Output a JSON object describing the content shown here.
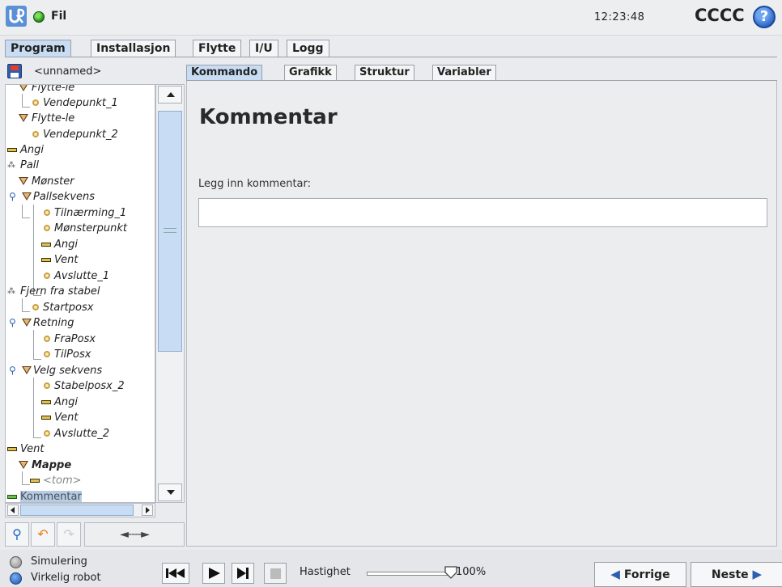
{
  "header": {
    "file_menu": "Fil",
    "clock": "12:23:48",
    "robot_name": "CCCC",
    "help_glyph": "?"
  },
  "main_tabs": [
    {
      "label": "Program",
      "active": true
    },
    {
      "label": "Installasjon",
      "active": false
    },
    {
      "label": "Flytte",
      "active": false
    },
    {
      "label": "I/U",
      "active": false
    },
    {
      "label": "Logg",
      "active": false
    }
  ],
  "program": {
    "name": "<unnamed>"
  },
  "tree": [
    {
      "label": "Flytte-le",
      "icon": "move-icon"
    },
    {
      "label": "Vendepunkt_1",
      "icon": "waypoint-icon"
    },
    {
      "label": "Flytte-le",
      "icon": "move-icon"
    },
    {
      "label": "Vendepunkt_2",
      "icon": "waypoint-icon"
    },
    {
      "label": "Angi",
      "icon": "set-icon"
    },
    {
      "label": "Pall",
      "icon": "pallet-icon"
    },
    {
      "label": "Mønster",
      "icon": "move-icon"
    },
    {
      "label": "Pallsekvens",
      "icon": "move-icon"
    },
    {
      "label": "Tilnærming_1",
      "icon": "waypoint-icon"
    },
    {
      "label": "Mønsterpunkt",
      "icon": "waypoint-icon"
    },
    {
      "label": "Angi",
      "icon": "set-icon"
    },
    {
      "label": "Vent",
      "icon": "set-icon"
    },
    {
      "label": "Avslutte_1",
      "icon": "waypoint-icon"
    },
    {
      "label": "Fjern fra stabel",
      "icon": "pallet-icon"
    },
    {
      "label": "Startposx",
      "icon": "waypoint-icon"
    },
    {
      "label": "Retning",
      "icon": "move-icon"
    },
    {
      "label": "FraPosx",
      "icon": "waypoint-icon"
    },
    {
      "label": "TilPosx",
      "icon": "waypoint-icon"
    },
    {
      "label": "Velg sekvens",
      "icon": "move-icon"
    },
    {
      "label": "Stabelposx_2",
      "icon": "waypoint-icon"
    },
    {
      "label": "Angi",
      "icon": "set-icon"
    },
    {
      "label": "Vent",
      "icon": "set-icon"
    },
    {
      "label": "Avslutte_2",
      "icon": "waypoint-icon"
    },
    {
      "label": "Vent",
      "icon": "set-icon"
    },
    {
      "label": "Mappe",
      "icon": "move-icon"
    },
    {
      "label": "<tom>",
      "icon": "set-icon"
    },
    {
      "label": "Kommentar",
      "icon": "comment-icon",
      "selected": true
    }
  ],
  "tree_tools": {
    "move_arrows": "◄----►"
  },
  "sub_tabs": [
    {
      "label": "Kommando",
      "active": true
    },
    {
      "label": "Grafikk",
      "active": false
    },
    {
      "label": "Struktur",
      "active": false
    },
    {
      "label": "Variabler",
      "active": false
    }
  ],
  "command": {
    "title": "Kommentar",
    "input_label": "Legg inn kommentar:",
    "input_value": ""
  },
  "footer": {
    "simulation": "Simulering",
    "real_robot": "Virkelig robot",
    "speed_label": "Hastighet",
    "speed_value": "100%",
    "speed_fraction": 1.0,
    "prev_label": "Forrige",
    "next_label": "Neste"
  }
}
